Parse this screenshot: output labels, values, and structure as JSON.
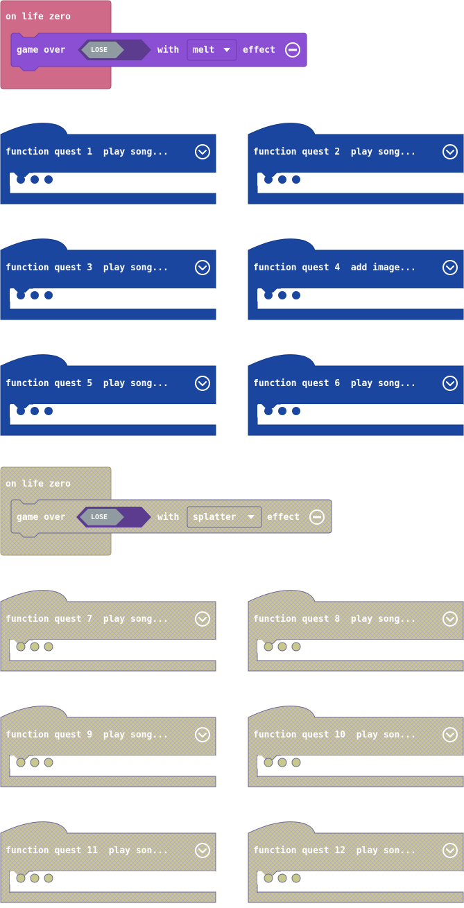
{
  "event_blocks": [
    {
      "hat_label": "on life zero",
      "game_over_label": "game over",
      "result_value": "LOSE",
      "with_label": "with",
      "effect_value": "melt",
      "effect_label": "effect",
      "state": "enabled"
    },
    {
      "hat_label": "on life zero",
      "game_over_label": "game over",
      "result_value": "LOSE",
      "with_label": "with",
      "effect_value": "splatter",
      "effect_label": "effect",
      "state": "disabled"
    }
  ],
  "function_blocks": [
    {
      "label": "function quest 1  play song...",
      "state": "enabled"
    },
    {
      "label": "function quest 2  play song...",
      "state": "enabled"
    },
    {
      "label": "function quest 3  play song...",
      "state": "enabled"
    },
    {
      "label": "function quest 4  add image...",
      "state": "enabled"
    },
    {
      "label": "function quest 5  play song...",
      "state": "enabled"
    },
    {
      "label": "function quest 6  play song...",
      "state": "enabled"
    },
    {
      "label": "function quest 7  play song...",
      "state": "disabled"
    },
    {
      "label": "function quest 8  play song...",
      "state": "disabled"
    },
    {
      "label": "function quest 9  play song...",
      "state": "disabled"
    },
    {
      "label": "function quest 10  play son...",
      "state": "disabled"
    },
    {
      "label": "function quest 11  play son...",
      "state": "disabled"
    },
    {
      "label": "function quest 12  play son...",
      "state": "disabled"
    }
  ],
  "colors": {
    "event_hat": "#d06a89",
    "event_hat_border": "#b04e6c",
    "game_over_block": "#8a4fd2",
    "game_over_border": "#6e3ab0",
    "lose_outer": "#5b3c8f",
    "lose_inner": "#8f9ba0",
    "function_block": "#1a46a0",
    "function_border": "#123a88",
    "disabled_fill": "#c6c58a",
    "disabled_hatch": "#b9a6c8",
    "disabled_border": "#6b6890"
  }
}
